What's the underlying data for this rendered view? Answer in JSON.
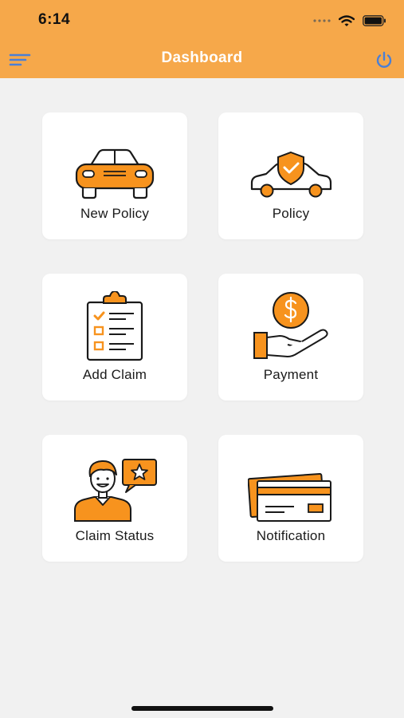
{
  "status_bar": {
    "time": "6:14"
  },
  "nav": {
    "title": "Dashboard",
    "menu_icon": "menu-icon",
    "power_icon": "power-icon"
  },
  "colors": {
    "accent": "#f6a84a",
    "icon_orange": "#f7931e",
    "power_blue": "#4a7fd6",
    "background": "#f1f1f1"
  },
  "tiles": [
    {
      "label": "New Policy",
      "icon": "car-front-icon"
    },
    {
      "label": "Policy",
      "icon": "car-shield-icon"
    },
    {
      "label": "Add Claim",
      "icon": "clipboard-checklist-icon"
    },
    {
      "label": "Payment",
      "icon": "hand-coin-icon"
    },
    {
      "label": "Claim Status",
      "icon": "person-star-icon"
    },
    {
      "label": "Notification",
      "icon": "credit-cards-icon"
    }
  ]
}
